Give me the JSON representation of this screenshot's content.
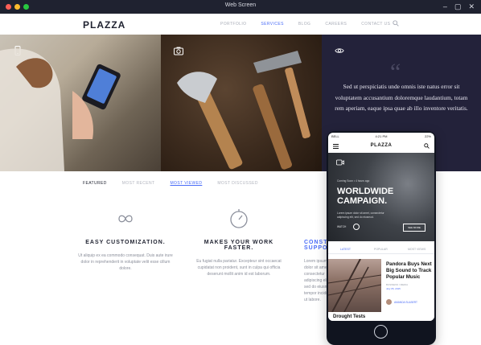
{
  "window": {
    "title": "Web Screen"
  },
  "header": {
    "logo": "PLAZZA",
    "nav": [
      "PORTFOLIO",
      "SERVICES",
      "BLOG",
      "CAREERS",
      "CONTACT US"
    ],
    "active_nav": "SERVICES"
  },
  "hero": {
    "quote": "Sed ut perspiciatis unde omnis iste natus error sit voluptatem accusantium doloremque laudantium, totam rem aperiam, eaque ipsa quae ab illo inventore veritatis."
  },
  "tabs": [
    "FEATURED",
    "MOST RECENT",
    "MOST VIEWED",
    "MOST DISCUSSED"
  ],
  "features": [
    {
      "title": "EASY CUSTOMIZATION.",
      "text": "Ut aliquip ex ea commodo consequat. Duis aute irure dolor in reprehenderit in voluptate velit esse cillum dolore."
    },
    {
      "title": "MAKES YOUR WORK FASTER.",
      "text": "Eu fugiat nulla pariatur. Excepteur sint occaecat cupidatat non proident, sunt in culpa qui officia deserunt mollit anim id est laborum."
    },
    {
      "title": "CONSTANT SUPPORT.",
      "text": "Lorem ipsum dolor sit amet, consectetur adipiscing elit, sed do eiusmod tempor incididunt ut labore."
    }
  ],
  "phone": {
    "status": {
      "carrier": "BELL",
      "time": "4:21 PM",
      "battery": "22%"
    },
    "logo": "PLAZZA",
    "hero": {
      "meta": "Coming Soon  •  4 hours ago",
      "headline_1": "WORLDWIDE",
      "headline_2": "CAMPAIGN.",
      "sub": "Lorem ipsum dolor sit amet, consectetur adipiscing elit, sed do eiusmod.",
      "watch": "WATCH",
      "more": "SEE MORE"
    },
    "tabs": [
      "LATEST",
      "POPULAR",
      "MOST VIEWS"
    ],
    "card": {
      "title": "Pandora Buys Next Big Sound to Track Popular Music",
      "category": "BUSINESS / MEDIA",
      "date": "July 05, 2015",
      "author": "AMANDA SULBERT"
    },
    "next_title": "Drought Tests"
  }
}
